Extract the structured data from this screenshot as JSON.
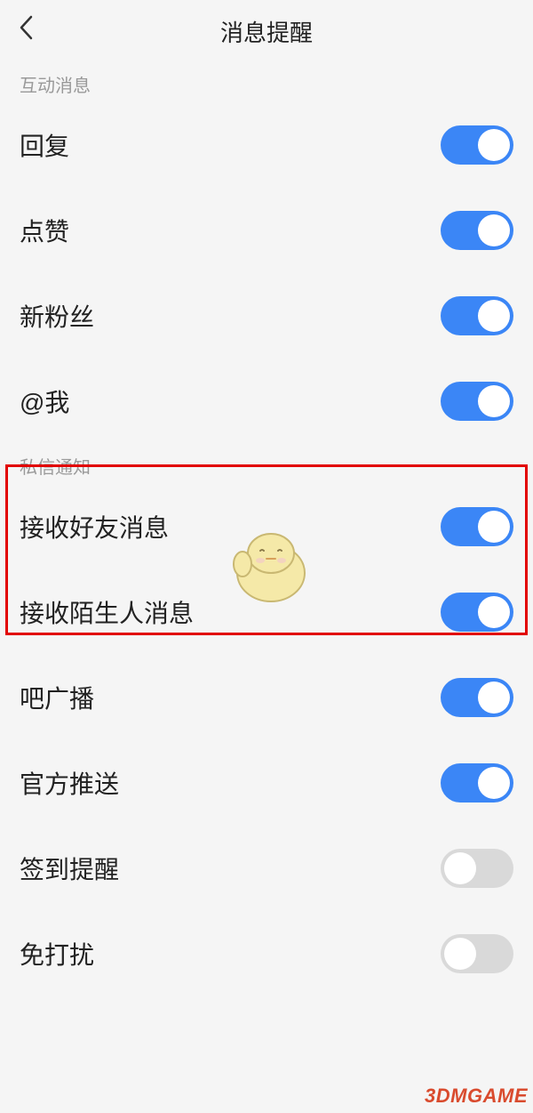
{
  "header": {
    "title": "消息提醒"
  },
  "sections": {
    "interactive": {
      "label": "互动消息",
      "items": [
        {
          "label": "回复",
          "on": true
        },
        {
          "label": "点赞",
          "on": true
        },
        {
          "label": "新粉丝",
          "on": true
        },
        {
          "label": "@我",
          "on": true
        }
      ]
    },
    "dm": {
      "label": "私信通知",
      "items": [
        {
          "label": "接收好友消息",
          "on": true
        },
        {
          "label": "接收陌生人消息",
          "on": true
        },
        {
          "label": "吧广播",
          "on": true
        },
        {
          "label": "官方推送",
          "on": true
        },
        {
          "label": "签到提醒",
          "on": false
        },
        {
          "label": "免打扰",
          "on": false
        }
      ]
    }
  },
  "watermark": "3DMGAME",
  "colors": {
    "toggleOn": "#3b86f6",
    "toggleOff": "#d9d9d9",
    "highlight": "#e20000"
  }
}
